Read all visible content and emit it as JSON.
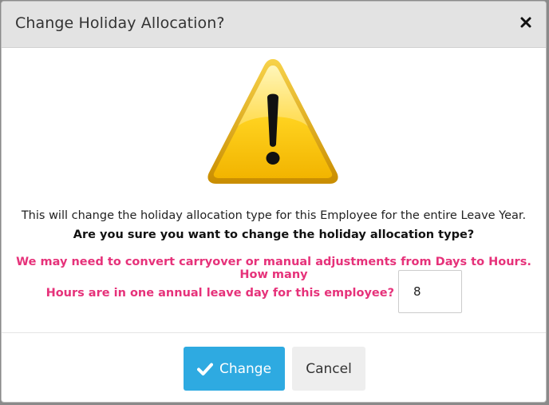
{
  "dialog": {
    "title": "Change Holiday Allocation?",
    "close_icon": "close-icon",
    "warning_icon": "warning-triangle-icon",
    "message_line_1": "This will change the holiday allocation type for this Employee for the entire Leave Year.",
    "message_line_2": "Are you sure you want to change the holiday allocation type?",
    "conversion_line_1": "We may need to convert carryover or manual adjustments from Days to Hours. How many",
    "conversion_line_2": "Hours are in one annual leave day for this employee?",
    "hours_input_value": "8",
    "change_button_label": "Change",
    "change_button_icon": "check-icon",
    "cancel_button_label": "Cancel"
  },
  "colors": {
    "header_bg": "#e3e3e3",
    "accent_blue": "#2eaae1",
    "warning_pink": "#e6327a",
    "warning_yellow": "#ffcf1a"
  }
}
